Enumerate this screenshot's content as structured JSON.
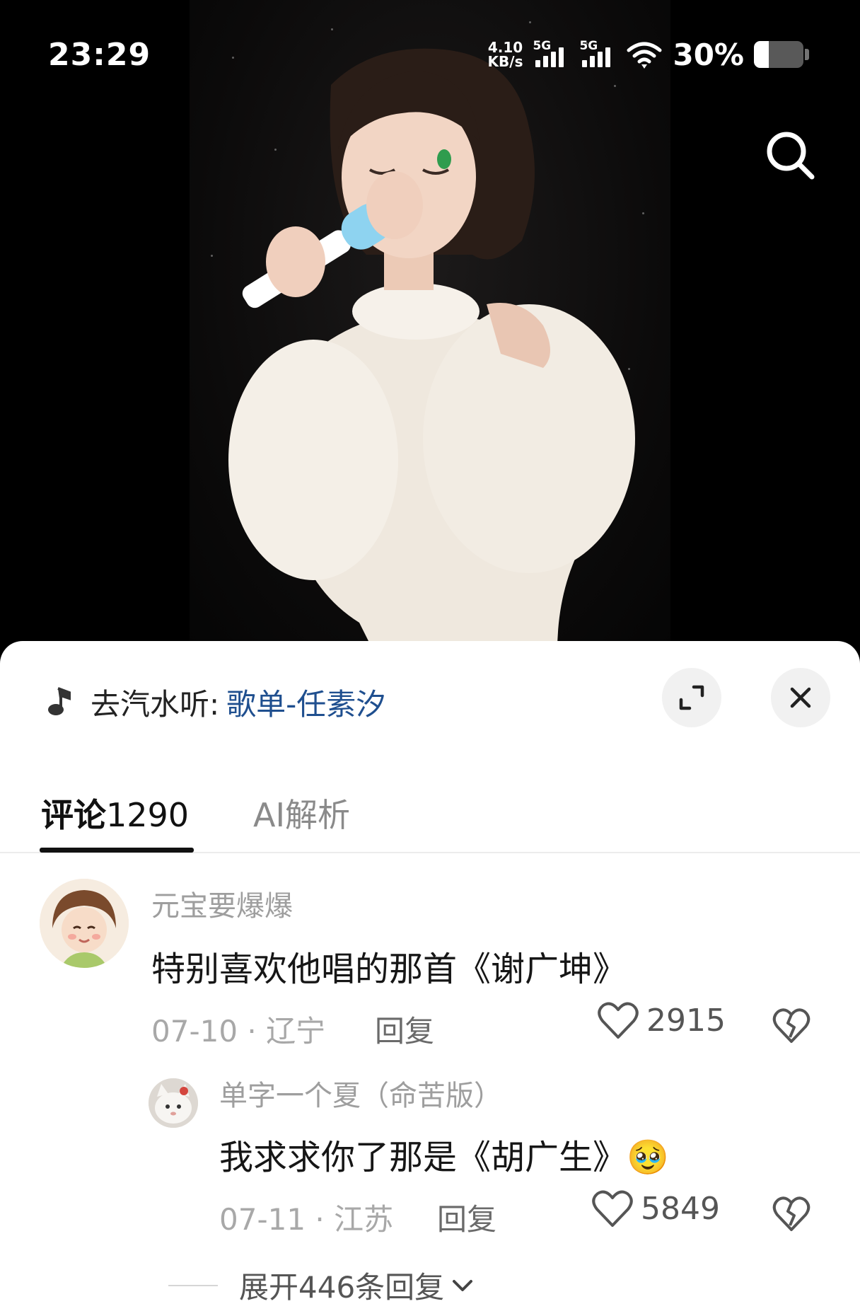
{
  "status_bar": {
    "time": "23:29",
    "net_speed_value": "4.10",
    "net_speed_unit": "KB/s",
    "sim1_tag": "5G",
    "sim2_tag": "5G",
    "battery_text": "30%",
    "battery_level": 0.3
  },
  "music_bar": {
    "prefix": "去汽水听:",
    "playlist": "歌单-任素汐"
  },
  "tabs": [
    {
      "label": "评论",
      "count": "1290",
      "active": true
    },
    {
      "label": "AI解析",
      "active": false
    }
  ],
  "comments": [
    {
      "username": "元宝要爆爆",
      "text": "特别喜欢他唱的那首《谢广坤》",
      "meta": "07-10 · 辽宁",
      "reply_label": "回复",
      "likes": "2915"
    }
  ],
  "replies": [
    {
      "username": "单字一个夏（命苦版）",
      "text": "我求求你了那是《胡广生》",
      "emoji": "🥹",
      "meta": "07-11 · 江苏",
      "reply_label": "回复",
      "likes": "5849"
    }
  ],
  "expand_label": "展开446条回复",
  "icons": [
    "search-icon",
    "music-note-icon",
    "expand-icon",
    "close-icon",
    "heart-icon",
    "broken-heart-icon",
    "chevron-down-icon"
  ]
}
